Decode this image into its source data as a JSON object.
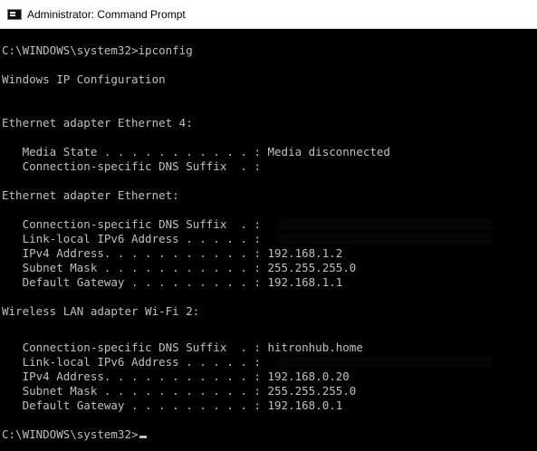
{
  "window": {
    "title": "Administrator: Command Prompt"
  },
  "console": {
    "lines": [
      "C:\\WINDOWS\\system32>ipconfig",
      "",
      "Windows IP Configuration",
      "",
      "",
      "Ethernet adapter Ethernet 4:",
      "",
      "   Media State . . . . . . . . . . . : Media disconnected",
      "   Connection-specific DNS Suffix  . :",
      "",
      "Ethernet adapter Ethernet:",
      "",
      "   Connection-specific DNS Suffix  . :",
      "   Link-local IPv6 Address . . . . . :",
      "   IPv4 Address. . . . . . . . . . . : 192.168.1.2",
      "   Subnet Mask . . . . . . . . . . . : 255.255.255.0",
      "   Default Gateway . . . . . . . . . : 192.168.1.1",
      "",
      "Wireless LAN adapter Wi-Fi 2:",
      "",
      "   Connection-specific DNS Suffix  . : hitronhub.home",
      "   Link-local IPv6 Address . . . . . :",
      "   IPv4 Address. . . . . . . . . . . : 192.168.0.20",
      "   Subnet Mask . . . . . . . . . . . : 255.255.255.0",
      "   Default Gateway . . . . . . . . . : 192.168.0.1",
      "",
      "C:\\WINDOWS\\system32>"
    ]
  },
  "icons": {
    "title": "cmd-app-icon",
    "cursor": "text-cursor"
  },
  "colors": {
    "console_bg": "#000000",
    "console_fg": "#c0c0c0",
    "titlebar_bg": "#ffffff"
  }
}
